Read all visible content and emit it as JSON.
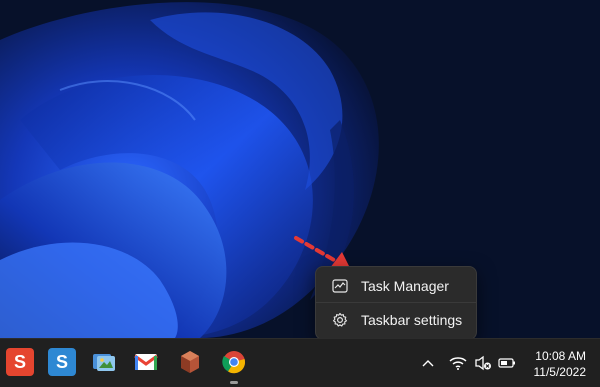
{
  "context_menu": {
    "items": [
      {
        "label": "Task Manager",
        "icon": "task-manager-icon"
      },
      {
        "label": "Taskbar settings",
        "icon": "gear-icon"
      }
    ]
  },
  "taskbar": {
    "apps": [
      {
        "name": "snagit-icon",
        "glyph": "S",
        "color": "#e5452f"
      },
      {
        "name": "snagit-editor-icon",
        "glyph": "S",
        "color": "#2e88d3"
      },
      {
        "name": "photos-icon",
        "glyph": "",
        "color": "#59a7d8"
      },
      {
        "name": "gmail-icon",
        "glyph": "M",
        "color": "#ea4335"
      },
      {
        "name": "app-icon",
        "glyph": "",
        "color": "#b55438"
      },
      {
        "name": "chrome-icon",
        "glyph": "",
        "color": "#2f9e44"
      }
    ],
    "tray": {
      "show_hidden_icons": "chevron-up-icon",
      "network": "wifi-icon",
      "volume": "volume-muted-icon",
      "battery": "battery-icon"
    },
    "clock": {
      "time": "10:08 AM",
      "date": "11/5/2022"
    }
  },
  "colors": {
    "wallpaper_bloom": "#1a4fe8",
    "taskbar_bg": "#202020",
    "menu_bg": "#2b2b2b",
    "arrow": "#e53935"
  }
}
